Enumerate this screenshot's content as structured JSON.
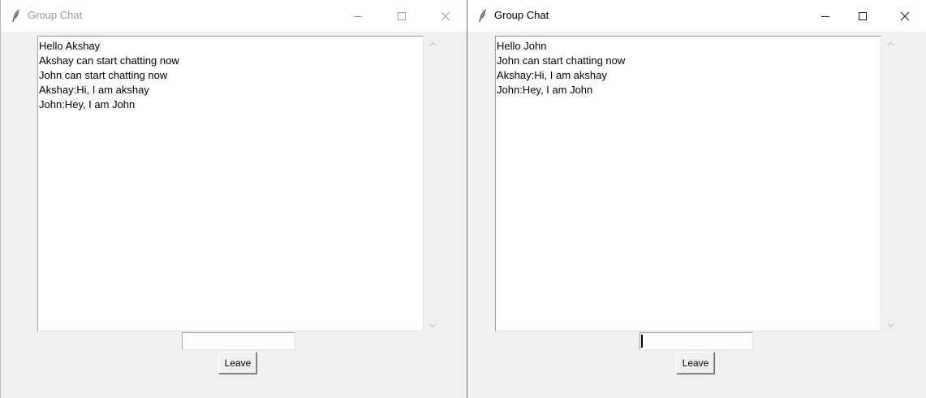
{
  "windows": [
    {
      "title": "Group Chat",
      "active": false,
      "messages": [
        "Hello Akshay",
        "Akshay can start chatting now",
        "John can start chatting now",
        "Akshay:Hi, I am akshay",
        "John:Hey, I am John"
      ],
      "entry_value": "",
      "leave_label": "Leave"
    },
    {
      "title": "Group Chat",
      "active": true,
      "messages": [
        "Hello John",
        "John can start chatting now",
        "Akshay:Hi, I am akshay",
        "John:Hey, I am John"
      ],
      "entry_value": "",
      "leave_label": "Leave"
    }
  ],
  "icons": {
    "app": "feather-icon",
    "minimize": "minimize-icon",
    "maximize": "maximize-icon",
    "close": "close-icon",
    "scroll_up": "chevron-up-icon",
    "scroll_down": "chevron-down-icon"
  }
}
